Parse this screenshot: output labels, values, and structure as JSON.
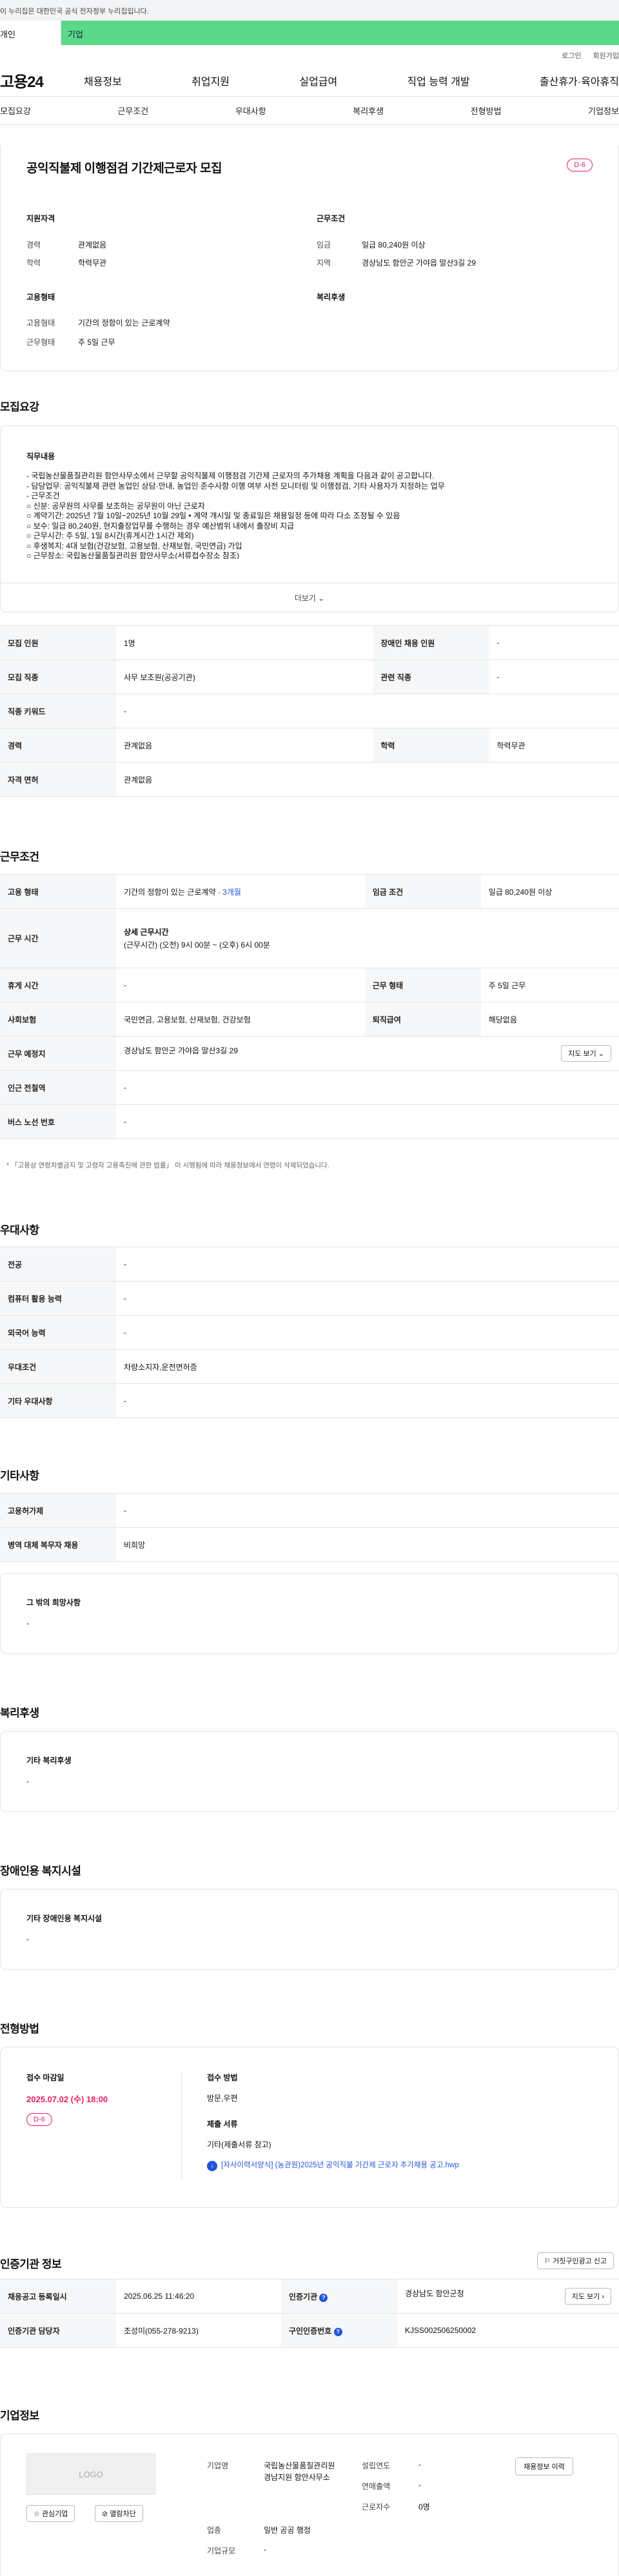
{
  "gov_banner": "이 누리집은 대한민국 공식 전자정부 누리집입니다.",
  "user_tabs": {
    "personal": "개인",
    "company": "기업"
  },
  "util": {
    "login": "로그인",
    "join": "회원가입"
  },
  "gnb": {
    "logo": "고용24",
    "menu": [
      "채용정보",
      "취업지원",
      "실업급여",
      "직업 능력 개발",
      "출산휴가·육아휴직"
    ]
  },
  "subtabs": [
    "모집요강",
    "근무조건",
    "우대사항",
    "복리후생",
    "전형방법",
    "기업정보"
  ],
  "summary": {
    "title": "공익직불제 이행점검 기간제근로자 모집",
    "dday": "D-6",
    "req_title": "지원자격",
    "career_label": "경력",
    "career": "관계없음",
    "edu_label": "학력",
    "edu": "학력무관",
    "emp_title": "고용형태",
    "emp_type_label": "고용형태",
    "emp_type": "기간의 정함이 있는 근로계약",
    "work_type_label": "근무형태",
    "work_type": "주 5일 근무",
    "cond_title": "근무조건",
    "wage_label": "임금",
    "wage": "일급 80,240원 이상",
    "region_label": "지역",
    "region": "경상남도 함안군 가야읍 말산3길 29",
    "welfare_title": "복리후생"
  },
  "recruit": {
    "section": "모집요강",
    "duty_title": "직무내용",
    "duty_lines": [
      "- 국립농산물품질관리원 함안사무소에서 근무할 공익직불제 이행점검 기간제 근로자의 추가채용 계획을 다음과 같이 공고합니다.",
      "- 담당업무: 공익직불제 관련 농업인 상담·안내, 농업인 준수사항 이행 여부 사전 모니터링 및 이행점검, 기타 사용자가 지정하는 업무",
      "- 근무조건",
      "○ 신분: 공무원의 사무를 보조하는 공무원이 아닌 근로자",
      "○ 계약기간: 2025년 7월 10일~2025년 10월 29일 • 계약 개시일 및 종료일은 채용일정 등에 따라 다소 조정될 수 있음",
      "○ 보수: 일급 80,240원, 현지출장업무를 수행하는 경우 예산범위 내에서 출장비 지급",
      "○ 근무시간: 주 5일, 1일 8시간(휴게시간 1시간 제외)",
      "○ 후생복지: 4대 보험(건강보험, 고용보험, 산재보험, 국민연금) 가입",
      "○ 근무장소: 국립농산물품질관리원 함안사무소(서류접수장소 참조)"
    ],
    "more": "더보기",
    "rows": [
      {
        "l1": "모집 인원",
        "v1": "1명",
        "l2": "장애인 채용 인원",
        "v2": "-"
      },
      {
        "l1": "모집 직종",
        "v1": "사무 보조원(공공기관)",
        "l2": "관련 직종",
        "v2": "-"
      },
      {
        "l1": "직종 키워드",
        "v1": "-"
      },
      {
        "l1": "경력",
        "v1": "관계없음",
        "l2": "학력",
        "v2": "학력무관"
      },
      {
        "l1": "자격 면허",
        "v1": "관계없음"
      }
    ]
  },
  "conditions": {
    "section": "근무조건",
    "emp_label": "고용 형태",
    "emp_value": "기간의 정함이 있는 근로계약",
    "emp_period": "3개월",
    "wage_label": "임금 조건",
    "wage_value": "일급 80,240원 이상",
    "time_label": "근무 시간",
    "time_title": "상세 근무시간",
    "time_value": "(근무시간) (오전) 9시 00분 ~ (오후) 6시 00분",
    "rest_label": "휴게 시간",
    "rest_value": "-",
    "type_label": "근무 형태",
    "type_value": "주 5일 근무",
    "ins_label": "사회보험",
    "ins_value": "국민연금, 고용보험, 산재보험, 건강보험",
    "ret_label": "퇴직급여",
    "ret_value": "해당없음",
    "loc_label": "근무 예정지",
    "loc_value": "경상남도 함안군 가야읍 말산3길 29",
    "map_btn": "지도 보기",
    "sub_label": "인근 전철역",
    "sub_value": "-",
    "bus_label": "버스 노선 번호",
    "bus_value": "-",
    "note": "* 「고용상 연령차별금지 및 고령자 고용촉진에 관한 법률」 이 시행됨에 따라 채용정보에서 연령이 삭제되었습니다."
  },
  "preferences": {
    "section": "우대사항",
    "rows": [
      {
        "l": "전공",
        "v": "-"
      },
      {
        "l": "컴퓨터 활용 능력",
        "v": "-"
      },
      {
        "l": "외국어 능력",
        "v": "-"
      },
      {
        "l": "우대조건",
        "v": "차량소지자,운전면허증"
      },
      {
        "l": "기타 우대사항",
        "v": "-"
      }
    ]
  },
  "others": {
    "section": "기타사항",
    "rows": [
      {
        "l": "고용허가제",
        "v": "-"
      },
      {
        "l": "병역 대체 복무자 채용",
        "v": "비희망"
      }
    ],
    "etc_title": "그 밖의 희망사항",
    "etc_value": "-"
  },
  "welfare": {
    "section": "복리후생",
    "title": "기타 복리후생",
    "value": "-"
  },
  "disability": {
    "section": "장애인용 복지시설",
    "title": "기타 장애인용 복지시설",
    "value": "-"
  },
  "selection": {
    "section": "전형방법",
    "deadline_title": "접수 마감일",
    "deadline": "2025.07.02 (수) 18:00",
    "dday": "D-6",
    "method_title": "접수 방법",
    "method": "방문,우편",
    "docs_title": "제출 서류",
    "docs": "기타(제출서류 참고)",
    "file": "[자사이력서양식] (농관원)2025년 공익직불 기간제 근로자 추가채용 공고.hwp"
  },
  "agency": {
    "section": "인증기관 정보",
    "report_btn": "거짓구인광고 신고",
    "reg_label": "채용공고 등록일시",
    "reg_value": "2025.06.25 11:46:20",
    "org_label": "인증기관",
    "org_value": "경상남도 함안군청",
    "map_btn": "지도 보기",
    "mgr_label": "인증기관 담당자",
    "mgr_value": "조성미(055-278-9213)",
    "num_label": "구인인증번호",
    "num_value": "KJSS002506250002"
  },
  "company": {
    "section": "기업정보",
    "logo": "LOGO",
    "fav_btn": "관심기업",
    "block_btn": "열람차단",
    "name_label": "기업명",
    "name": "국립농산물품질관리원경남지원 함안사무소",
    "year_label": "설립연도",
    "year": "-",
    "sales_label": "연매출액",
    "sales": "-",
    "staff_label": "근로자수",
    "staff": "0명",
    "biz_label": "업종",
    "biz": "일반 공공 행정",
    "size_label": "기업규모",
    "size": "-",
    "jobs_btn": "채용정보 이력"
  },
  "colors": {
    "accent": "#5bd889",
    "dday": "#e91e63",
    "link": "#2454d8"
  }
}
